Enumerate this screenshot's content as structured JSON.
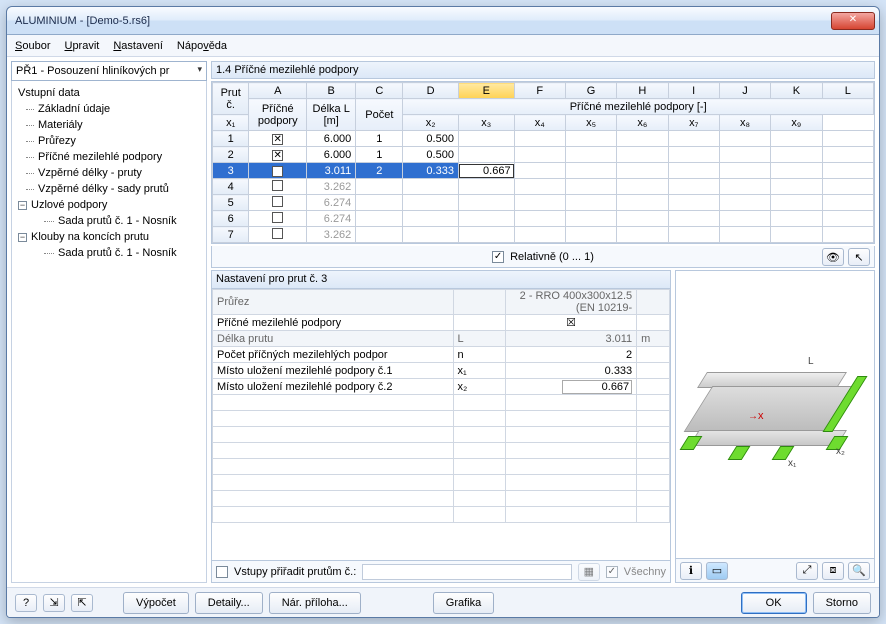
{
  "window": {
    "title": "ALUMINIUM - [Demo-5.rs6]"
  },
  "menu": {
    "soubor": "Soubor",
    "upravit": "Upravit",
    "nastaveni": "Nastavení",
    "napoveda": "Nápověda"
  },
  "nav": {
    "combo": "PŘ1 - Posouzení hliníkových pr",
    "root": "Vstupní data",
    "items": [
      "Základní údaje",
      "Materiály",
      "Průřezy",
      "Příčné mezilehlé podpory",
      "Vzpěrné délky - pruty",
      "Vzpěrné délky - sady prutů"
    ],
    "uzlove": "Uzlové podpory",
    "uzlove_sub": "Sada prutů č. 1 - Nosník",
    "klouby": "Klouby na koncích prutu",
    "klouby_sub": "Sada prutů č. 1 - Nosník"
  },
  "panel": {
    "title": "1.4 Příčné mezilehlé podpory"
  },
  "grid": {
    "cols_letters": [
      "A",
      "B",
      "C",
      "D",
      "E",
      "F",
      "G",
      "H",
      "I",
      "J",
      "K",
      "L"
    ],
    "h_prut": "Prut č.",
    "h_pricne": "Příčné podpory",
    "h_delka": "Délka L [m]",
    "h_pocet": "Počet",
    "h_group": "Příčné mezilehlé podpory [-]",
    "h_x": [
      "x₁",
      "x₂",
      "x₃",
      "x₄",
      "x₅",
      "x₆",
      "x₇",
      "x₈",
      "x₉"
    ],
    "rows": [
      {
        "n": "1",
        "chk": true,
        "L": "6.000",
        "pocet": "1",
        "x1": "0.500",
        "x2": ""
      },
      {
        "n": "2",
        "chk": true,
        "L": "6.000",
        "pocet": "1",
        "x1": "0.500",
        "x2": ""
      },
      {
        "n": "3",
        "chk": true,
        "L": "3.011",
        "pocet": "2",
        "x1": "0.333",
        "x2": "0.667"
      },
      {
        "n": "4",
        "chk": false,
        "L": "3.262",
        "pocet": "",
        "x1": "",
        "x2": ""
      },
      {
        "n": "5",
        "chk": false,
        "L": "6.274",
        "pocet": "",
        "x1": "",
        "x2": ""
      },
      {
        "n": "6",
        "chk": false,
        "L": "6.274",
        "pocet": "",
        "x1": "",
        "x2": ""
      },
      {
        "n": "7",
        "chk": false,
        "L": "3.262",
        "pocet": "",
        "x1": "",
        "x2": ""
      }
    ],
    "relative": "Relativně (0 ... 1)"
  },
  "detail": {
    "title": "Nastavení pro prut č. 3",
    "rows": [
      {
        "label": "Průřez",
        "sym": "",
        "val": "2 - RRO 400x300x12.5 (EN 10219-",
        "unit": "",
        "gray": true
      },
      {
        "label": "Příčné mezilehlé podpory",
        "sym": "",
        "val": "☒",
        "unit": "",
        "gray": false,
        "center": true
      },
      {
        "label": "Délka prutu",
        "sym": "L",
        "val": "3.011",
        "unit": "m",
        "gray": true
      },
      {
        "label": "Počet příčných mezilehlých podpor",
        "sym": "n",
        "val": "2",
        "unit": "",
        "gray": false
      },
      {
        "label": "Místo uložení mezilehlé podpory č.1",
        "sym": "x₁",
        "val": "0.333",
        "unit": "",
        "gray": false
      },
      {
        "label": "Místo uložení mezilehlé podpory č.2",
        "sym": "x₂",
        "val": "0.667",
        "unit": "",
        "gray": false,
        "editing": true
      }
    ],
    "assign_label": "Vstupy přiřadit prutům č.:",
    "all_label": "Všechny"
  },
  "buttons": {
    "vypocet": "Výpočet",
    "detaily": "Detaily...",
    "priloha": "Nár. příloha...",
    "grafika": "Grafika",
    "ok": "OK",
    "storno": "Storno"
  },
  "beam_labels": {
    "L": "L",
    "x": "x",
    "x1": "x₁",
    "x2": "x₂"
  }
}
